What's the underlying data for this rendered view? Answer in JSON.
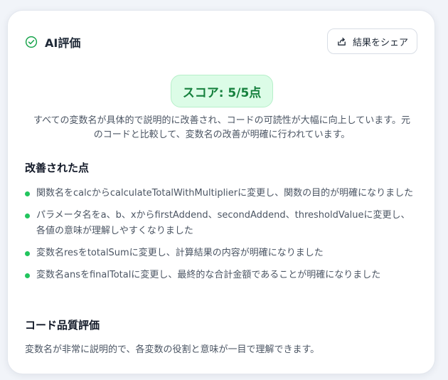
{
  "header": {
    "title": "AI評価",
    "share_label": "結果をシェア"
  },
  "score": {
    "label": "スコア: 5/5点"
  },
  "summary": "すべての変数名が具体的で説明的に改善され、コードの可読性が大幅に向上しています。元のコードと比較して、変数名の改善が明確に行われています。",
  "improvements": {
    "title": "改善された点",
    "items": [
      "関数名をcalcからcalculateTotalWithMultiplierに変更し、関数の目的が明確になりました",
      "パラメータ名をa、b、xからfirstAddend、secondAddend、thresholdValueに変更し、各値の意味が理解しやすくなりました",
      "変数名resをtotalSumに変更し、計算結果の内容が明確になりました",
      "変数名ansをfinalTotalに変更し、最終的な合計金額であることが明確になりました"
    ]
  },
  "quality": {
    "title": "コード品質評価",
    "text": "変数名が非常に説明的で、各変数の役割と意味が一目で理解できます。"
  },
  "colors": {
    "accent_green": "#22c55e",
    "score_bg": "#dcfce7",
    "score_text": "#15803d"
  },
  "icons": {
    "title_icon": "check-circle-icon",
    "share_icon": "share-icon",
    "bullet_icon": "bullet-dot-icon"
  }
}
